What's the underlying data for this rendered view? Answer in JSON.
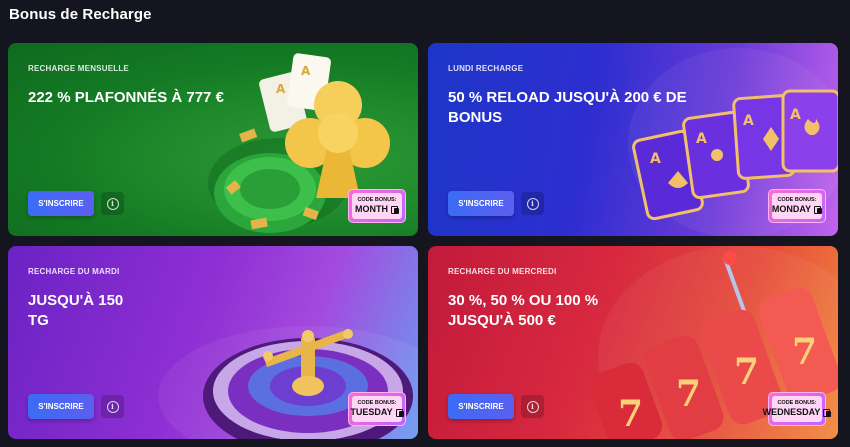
{
  "section_title": "Bonus de Recharge",
  "cards": [
    {
      "eyebrow": "RECHARGE MENSUELLE",
      "headline": "222 % PLAFONNÉS À 777 €",
      "cta_label": "S'INSCRIRE",
      "info_glyph": "i",
      "code_label": "CODE BONUS:",
      "code_value": "MONTH",
      "art": "card-club-chips",
      "bg_color": "#1f8a2c"
    },
    {
      "eyebrow": "LUNDI RECHARGE",
      "headline": "50 % RELOAD JUSQU'À 200 € DE BONUS",
      "cta_label": "S'INSCRIRE",
      "info_glyph": "i",
      "code_label": "CODE BONUS:",
      "code_value": "MONDAY",
      "art": "ace-cards-fan",
      "bg_color": "#2e2ed0"
    },
    {
      "eyebrow": "RECHARGE DU MARDI",
      "headline": "JUSQU'À 150 TG",
      "cta_label": "S'INSCRIRE",
      "info_glyph": "i",
      "code_label": "CODE BONUS:",
      "code_value": "TUESDAY",
      "art": "roulette-wheel",
      "bg_color": "#8e2fd3"
    },
    {
      "eyebrow": "RECHARGE DU MERCREDI",
      "headline": "30 %, 50 % OU 100 % JUSQU'À 500 €",
      "cta_label": "S'INSCRIRE",
      "info_glyph": "i",
      "code_label": "CODE BONUS:",
      "code_value": "WEDNESDAY",
      "art": "slot-machine-777",
      "bg_color": "#d7283f"
    }
  ]
}
